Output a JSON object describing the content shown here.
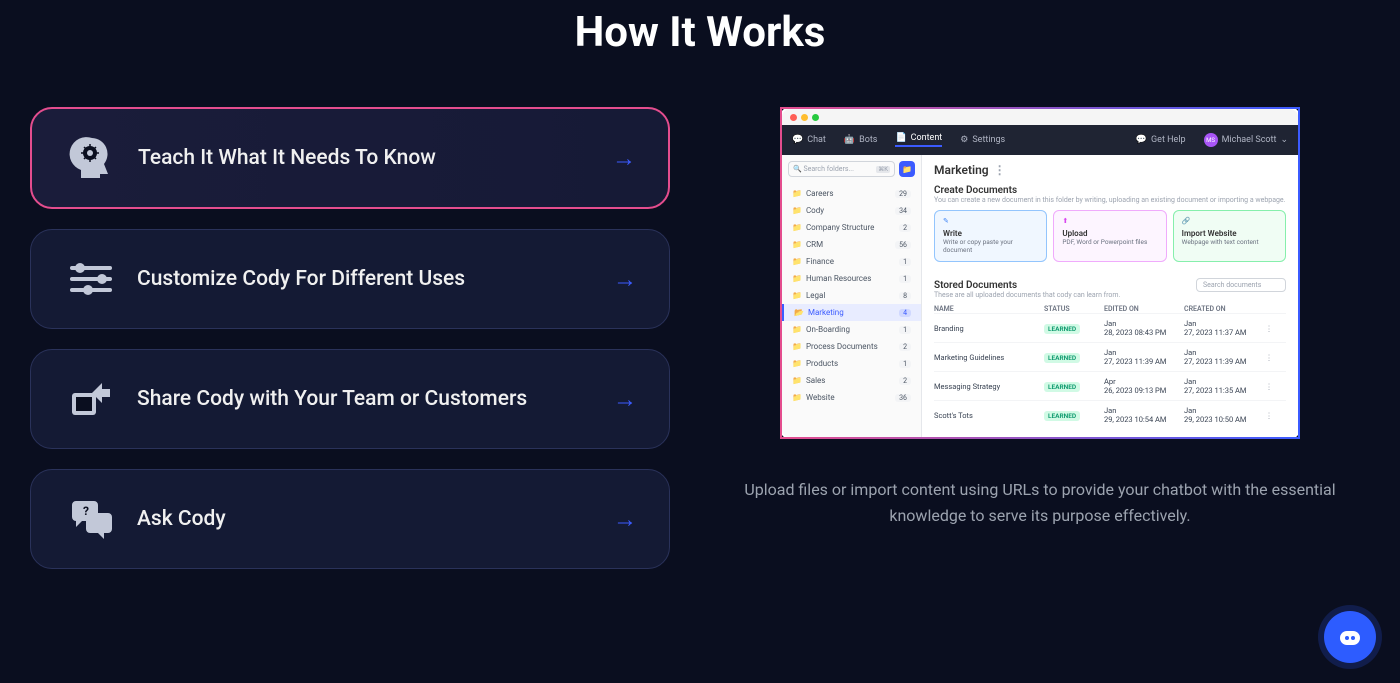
{
  "heading": "How It Works",
  "cards": [
    {
      "label": "Teach It What It Needs To Know",
      "active": true
    },
    {
      "label": "Customize Cody For Different Uses",
      "active": false
    },
    {
      "label": "Share Cody with Your Team or Customers",
      "active": false
    },
    {
      "label": "Ask Cody",
      "active": false
    }
  ],
  "app": {
    "nav": {
      "chat": "Chat",
      "bots": "Bots",
      "content": "Content",
      "settings": "Settings",
      "get_help": "Get Help",
      "user": "Michael Scott",
      "avatar_initials": "MS"
    },
    "search_placeholder": "Search folders...",
    "search_kbd": "⌘K",
    "folders": [
      {
        "name": "Careers",
        "count": "29"
      },
      {
        "name": "Cody",
        "count": "34"
      },
      {
        "name": "Company Structure",
        "count": "2"
      },
      {
        "name": "CRM",
        "count": "56"
      },
      {
        "name": "Finance",
        "count": "1"
      },
      {
        "name": "Human Resources",
        "count": "1"
      },
      {
        "name": "Legal",
        "count": "8"
      },
      {
        "name": "Marketing",
        "count": "4",
        "selected": true
      },
      {
        "name": "On-Boarding",
        "count": "1"
      },
      {
        "name": "Process Documents",
        "count": "2"
      },
      {
        "name": "Products",
        "count": "1"
      },
      {
        "name": "Sales",
        "count": "2"
      },
      {
        "name": "Website",
        "count": "36"
      }
    ],
    "folder_title": "Marketing",
    "create": {
      "title": "Create Documents",
      "sub": "You can create a new document in this folder by writing, uploading an existing document or importing a webpage.",
      "write": {
        "title": "Write",
        "sub": "Write or copy paste your document"
      },
      "upload": {
        "title": "Upload",
        "sub": "PDF, Word or Powerpoint files"
      },
      "import": {
        "title": "Import Website",
        "sub": "Webpage with text content"
      }
    },
    "stored": {
      "title": "Stored Documents",
      "sub": "These are all uploaded documents that cody can learn from.",
      "search_placeholder": "Search documents",
      "cols": {
        "name": "NAME",
        "status": "STATUS",
        "edited": "EDITED ON",
        "created": "CREATED ON"
      },
      "rows": [
        {
          "name": "Branding",
          "status": "LEARNED",
          "edited": "Jan 28, 2023 08:43 PM",
          "created": "Jan 27, 2023 11:37 AM"
        },
        {
          "name": "Marketing Guidelines",
          "status": "LEARNED",
          "edited": "Jan 27, 2023 11:39 AM",
          "created": "Jan 27, 2023 11:39 AM"
        },
        {
          "name": "Messaging Strategy",
          "status": "LEARNED",
          "edited": "Apr 26, 2023 09:13 PM",
          "created": "Jan 27, 2023 11:35 AM"
        },
        {
          "name": "Scott's Tots",
          "status": "LEARNED",
          "edited": "Jan 29, 2023 10:54 AM",
          "created": "Jan 29, 2023 10:50 AM"
        }
      ]
    }
  },
  "caption": "Upload files or import content using URLs to provide your chatbot with the essential knowledge to serve its purpose effectively."
}
